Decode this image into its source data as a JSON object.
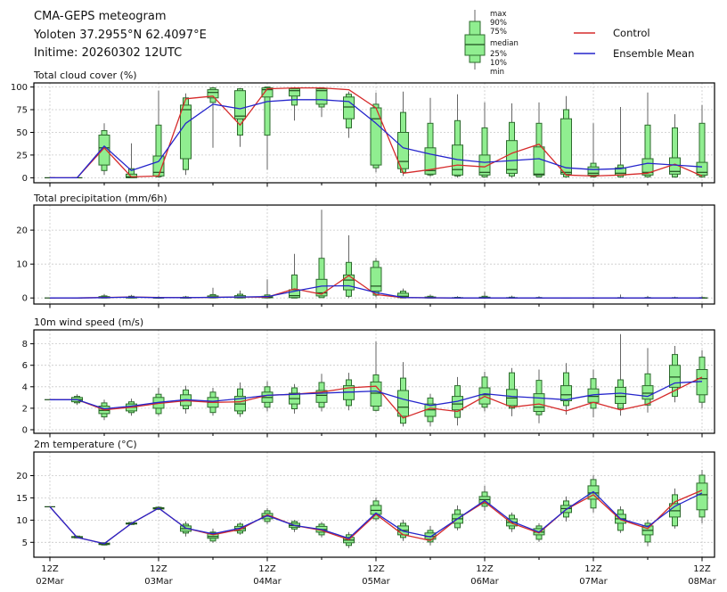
{
  "header": {
    "title": "CMA-GEPS meteogram",
    "location": "Yoloten 37.2955°N 62.4097°E",
    "inittime": "Initime: 20260302 12UTC"
  },
  "legend": {
    "box_labels": [
      "max",
      "90%",
      "75%",
      "median",
      "25%",
      "10%",
      "min"
    ],
    "control_label": "Control",
    "ensemble_label": "Ensemble Mean"
  },
  "style": {
    "control_color": "#d62b2b",
    "ensemble_color": "#2525cc",
    "box_fill": "#90ee90",
    "box_edge": "#2e6b2e",
    "median_color": "#1e4d1e",
    "whisker_color": "#666666",
    "grid_color": "#c9c9c9",
    "axis_color": "#000000"
  },
  "x_axis": {
    "start": "02Mar 12Z",
    "step_hours": 6,
    "n_steps": 25,
    "major_tick_labels": [
      {
        "hour": "12Z",
        "date": "02Mar"
      },
      {
        "hour": "12Z",
        "date": "03Mar"
      },
      {
        "hour": "12Z",
        "date": "04Mar"
      },
      {
        "hour": "12Z",
        "date": "05Mar"
      },
      {
        "hour": "12Z",
        "date": "06Mar"
      },
      {
        "hour": "12Z",
        "date": "07Mar"
      },
      {
        "hour": "12Z",
        "date": "08Mar"
      }
    ]
  },
  "chart_data": [
    {
      "type": "box",
      "id": "total-cloud-cover",
      "title": "Total cloud cover (%)",
      "ylim": [
        0,
        100
      ],
      "yticks": [
        0,
        25,
        50,
        75,
        100
      ],
      "box_stats_order": [
        "min",
        "p10",
        "p25",
        "median",
        "p75",
        "p90",
        "max"
      ],
      "boxes": [
        [
          0,
          0,
          0,
          0,
          0,
          0,
          0
        ],
        [
          0,
          0,
          0,
          0,
          0,
          0,
          0
        ],
        [
          3,
          8,
          14,
          33,
          47,
          52,
          60
        ],
        [
          0,
          0,
          0,
          1,
          4,
          10,
          38
        ],
        [
          0,
          1,
          2,
          6,
          24,
          58,
          96
        ],
        [
          3,
          9,
          21,
          75,
          80,
          88,
          93
        ],
        [
          33,
          83,
          88,
          94,
          97,
          99,
          100
        ],
        [
          34,
          47,
          65,
          68,
          96,
          98,
          99
        ],
        [
          9,
          47,
          89,
          97,
          99,
          100,
          100
        ],
        [
          63,
          80,
          90,
          96,
          98,
          99,
          100
        ],
        [
          67,
          78,
          81,
          96,
          98,
          99,
          100
        ],
        [
          44,
          55,
          65,
          78,
          89,
          92,
          95
        ],
        [
          6,
          11,
          14,
          65,
          77,
          81,
          94
        ],
        [
          2,
          6,
          10,
          18,
          50,
          72,
          95
        ],
        [
          1,
          3,
          4,
          8,
          33,
          60,
          88
        ],
        [
          0,
          2,
          3,
          9,
          36,
          63,
          92
        ],
        [
          0,
          1,
          3,
          6,
          25,
          55,
          83
        ],
        [
          0,
          2,
          5,
          9,
          41,
          61,
          82
        ],
        [
          0,
          1,
          3,
          4,
          34,
          60,
          83
        ],
        [
          0,
          1,
          4,
          6,
          65,
          75,
          90
        ],
        [
          0,
          1,
          3,
          5,
          12,
          16,
          60
        ],
        [
          0,
          1,
          3,
          5,
          11,
          14,
          78
        ],
        [
          0,
          1,
          3,
          6,
          21,
          58,
          94
        ],
        [
          0,
          1,
          4,
          7,
          22,
          55,
          70
        ],
        [
          0,
          1,
          3,
          6,
          17,
          60,
          80
        ]
      ],
      "control": [
        0,
        0,
        33,
        1,
        2,
        87,
        90,
        58,
        98,
        99,
        99,
        97,
        77,
        5,
        9,
        14,
        12,
        27,
        37,
        3,
        2,
        3,
        5,
        15,
        2
      ],
      "ensemble": [
        0,
        0,
        35,
        8,
        18,
        60,
        81,
        76,
        84,
        86,
        86,
        84,
        60,
        33,
        26,
        20,
        17,
        19,
        21,
        11,
        9,
        10,
        16,
        14,
        12
      ]
    },
    {
      "type": "box",
      "id": "total-precipitation",
      "title": "Total precipitation (mm/6h)",
      "ylim": [
        0,
        25
      ],
      "yticks": [
        0,
        10,
        20
      ],
      "box_stats_order": [
        "min",
        "p10",
        "p25",
        "median",
        "p75",
        "p90",
        "max"
      ],
      "boxes": [
        [
          0,
          0,
          0,
          0,
          0,
          0,
          0
        ],
        [
          0,
          0,
          0,
          0,
          0,
          0,
          0.1
        ],
        [
          0,
          0,
          0,
          0.1,
          0.4,
          0.6,
          1.2
        ],
        [
          0,
          0,
          0,
          0.1,
          0.3,
          0.5,
          0.9
        ],
        [
          0,
          0,
          0,
          0,
          0.1,
          0.2,
          0.5
        ],
        [
          0,
          0,
          0,
          0.05,
          0.15,
          0.3,
          0.6
        ],
        [
          0,
          0,
          0.05,
          0.25,
          0.6,
          1,
          3
        ],
        [
          0,
          0,
          0.05,
          0.3,
          0.7,
          1.1,
          2.2
        ],
        [
          0,
          0,
          0.05,
          0.2,
          0.5,
          0.9,
          5.5
        ],
        [
          0,
          0,
          0.1,
          0.7,
          2.4,
          6.8,
          13
        ],
        [
          0,
          0.1,
          0.6,
          1.5,
          5.5,
          11.7,
          26
        ],
        [
          0,
          0.5,
          2.4,
          5.3,
          6.8,
          10.5,
          18.5
        ],
        [
          0.2,
          0.8,
          2,
          3.5,
          9,
          10.8,
          11.8
        ],
        [
          0,
          0,
          0.1,
          0.5,
          1.4,
          2,
          2.8
        ],
        [
          0,
          0,
          0,
          0.1,
          0.3,
          0.5,
          1
        ],
        [
          0,
          0,
          0,
          0,
          0.1,
          0.2,
          0.5
        ],
        [
          0,
          0,
          0,
          0.05,
          0.25,
          0.5,
          1.8
        ],
        [
          0,
          0,
          0,
          0,
          0.1,
          0.25,
          0.7
        ],
        [
          0,
          0,
          0,
          0,
          0.05,
          0.15,
          0.5
        ],
        [
          0,
          0,
          0,
          0,
          0,
          0.05,
          0.2
        ],
        [
          0,
          0,
          0,
          0,
          0,
          0.05,
          0.3
        ],
        [
          0,
          0,
          0,
          0,
          0.05,
          0.1,
          1
        ],
        [
          0,
          0,
          0,
          0,
          0.05,
          0.15,
          0.6
        ],
        [
          0,
          0,
          0,
          0,
          0,
          0.1,
          0.4
        ],
        [
          0,
          0,
          0,
          0,
          0.05,
          0.1,
          0.5
        ]
      ],
      "control": [
        0,
        0,
        0.15,
        0.3,
        0.15,
        0.1,
        0.2,
        0.3,
        0.25,
        2.7,
        1.1,
        6.6,
        1,
        0.1,
        0.05,
        0,
        0,
        0,
        0,
        0,
        0,
        0,
        0,
        0,
        0
      ],
      "ensemble": [
        0,
        0,
        0.1,
        0.25,
        0.1,
        0.1,
        0.2,
        0.3,
        0.4,
        2,
        3.5,
        3.6,
        1.6,
        0.15,
        0.05,
        0,
        0,
        0,
        0,
        0,
        0,
        0,
        0,
        0,
        0
      ]
    },
    {
      "type": "box",
      "id": "10m-wind-speed",
      "title": "10m wind speed (m/s)",
      "ylim": [
        0,
        9
      ],
      "yticks": [
        0,
        2,
        4,
        6,
        8
      ],
      "box_stats_order": [
        "min",
        "p10",
        "p25",
        "median",
        "p75",
        "p90",
        "max"
      ],
      "boxes": [
        [
          2.8,
          2.8,
          2.8,
          2.8,
          2.8,
          2.8,
          2.8
        ],
        [
          2.3,
          2.5,
          2.6,
          2.8,
          3,
          3.1,
          3.3
        ],
        [
          0.9,
          1.2,
          1.5,
          1.8,
          2.2,
          2.5,
          2.8
        ],
        [
          1.3,
          1.6,
          1.75,
          2.1,
          2.4,
          2.6,
          2.9
        ],
        [
          1.3,
          1.5,
          2,
          2.5,
          3,
          3.3,
          3.9
        ],
        [
          1.5,
          1.95,
          2.25,
          2.75,
          3.25,
          3.7,
          4.1
        ],
        [
          1.3,
          1.6,
          2.1,
          2.55,
          3,
          3.5,
          3.9
        ],
        [
          1.2,
          1.5,
          1.75,
          2.4,
          3.1,
          3.8,
          4.4
        ],
        [
          1.7,
          2.1,
          2.55,
          3,
          3.5,
          4,
          4.5
        ],
        [
          1.5,
          1.95,
          2.4,
          2.9,
          3.4,
          3.9,
          4.25
        ],
        [
          1.7,
          2.1,
          2.55,
          3.2,
          3.65,
          4.4,
          5.2
        ],
        [
          1.8,
          2.25,
          2.8,
          3.5,
          4.1,
          4.65,
          5.3
        ],
        [
          1.7,
          1.8,
          2.2,
          3.4,
          4.45,
          5.1,
          8.2
        ],
        [
          0.3,
          0.6,
          1.25,
          2.1,
          3.65,
          4.8,
          6.3
        ],
        [
          0.3,
          0.75,
          1.25,
          1.85,
          2.4,
          2.95,
          3.35
        ],
        [
          0.4,
          1.15,
          1.85,
          2.4,
          3.1,
          4.1,
          4.9
        ],
        [
          1.7,
          2.1,
          2.4,
          3.25,
          3.9,
          4.9,
          5.4
        ],
        [
          1.25,
          2,
          2.25,
          2.95,
          3.75,
          5.3,
          5.75
        ],
        [
          0.6,
          1.4,
          1.7,
          2.1,
          3.35,
          4.6,
          5.6
        ],
        [
          1.4,
          2.25,
          2.7,
          3.25,
          4.1,
          5.3,
          6.2
        ],
        [
          1.15,
          2,
          2.55,
          3.1,
          3.8,
          4.75,
          5.6
        ],
        [
          1.3,
          2,
          2.45,
          3.1,
          3.95,
          4.65,
          8.9
        ],
        [
          1.6,
          2.3,
          2.85,
          3.4,
          4.1,
          5.2,
          7.6
        ],
        [
          2.55,
          3.1,
          3.95,
          4.9,
          6,
          7,
          7.8
        ],
        [
          2,
          2.55,
          3.25,
          4.75,
          5.6,
          6.75,
          7.4
        ]
      ],
      "control": [
        2.8,
        2.8,
        1.85,
        2.1,
        2.45,
        2.7,
        2.55,
        2.6,
        3.2,
        3.3,
        3.5,
        3.9,
        4.05,
        1.1,
        2,
        1.7,
        3.1,
        2.1,
        2.4,
        1.75,
        2.55,
        1.85,
        2.4,
        3.65,
        4.9
      ],
      "ensemble": [
        2.8,
        2.8,
        1.95,
        2.2,
        2.55,
        2.8,
        2.65,
        2.9,
        3.2,
        3.3,
        3.4,
        3.5,
        3.6,
        2.85,
        2.25,
        2.65,
        3.35,
        3.1,
        2.95,
        2.8,
        3.25,
        3.4,
        3.1,
        4.35,
        4.5
      ]
    },
    {
      "type": "box",
      "id": "2m-temperature",
      "title": "2m temperature (°C)",
      "ylim": [
        2,
        25
      ],
      "yticks": [
        5,
        10,
        15,
        20
      ],
      "box_stats_order": [
        "min",
        "p10",
        "p25",
        "median",
        "p75",
        "p90",
        "max"
      ],
      "boxes": [
        [
          13,
          13,
          13,
          13,
          13,
          13,
          13
        ],
        [
          5.9,
          6,
          6.05,
          6.1,
          6.3,
          6.4,
          6.5
        ],
        [
          4.3,
          4.4,
          4.5,
          4.65,
          4.8,
          4.9,
          5
        ],
        [
          8.9,
          9,
          9.1,
          9.2,
          9.35,
          9.45,
          9.6
        ],
        [
          12.3,
          12.4,
          12.5,
          12.65,
          12.8,
          12.9,
          13.1
        ],
        [
          6.3,
          7.1,
          7.5,
          8.1,
          8.7,
          9.1,
          9.7
        ],
        [
          4.9,
          5.3,
          5.9,
          6.3,
          7.1,
          7.3,
          8.1
        ],
        [
          6.7,
          7.1,
          7.6,
          8.1,
          8.6,
          9.1,
          9.5
        ],
        [
          9.1,
          9.7,
          10.3,
          10.9,
          11.5,
          12.1,
          12.7
        ],
        [
          7.3,
          8,
          8.4,
          8.8,
          9.3,
          9.7,
          10
        ],
        [
          6.1,
          6.7,
          7.3,
          7.9,
          8.6,
          9.1,
          9.6
        ],
        [
          3.7,
          4.3,
          4.9,
          5.5,
          6.1,
          6.7,
          7.3
        ],
        [
          9.7,
          10.3,
          11.3,
          12.2,
          13.3,
          14.3,
          15.1
        ],
        [
          5.3,
          6.1,
          6.7,
          7.7,
          8.7,
          9.3,
          10.1
        ],
        [
          4.3,
          5.1,
          5.7,
          6.3,
          7.1,
          7.7,
          8.7
        ],
        [
          7.7,
          8.3,
          9.3,
          10.3,
          11.3,
          12.3,
          13.3
        ],
        [
          12.1,
          13.1,
          13.7,
          14.6,
          15.3,
          16.3,
          17.7
        ],
        [
          7.3,
          8.1,
          8.7,
          9.5,
          10.3,
          11.1,
          11.7
        ],
        [
          5.1,
          5.7,
          6.7,
          7.3,
          8.1,
          8.7,
          9.3
        ],
        [
          9.7,
          10.7,
          11.7,
          12.6,
          13.3,
          14.3,
          15.3
        ],
        [
          11.7,
          12.7,
          14.7,
          16.1,
          17.7,
          19.1,
          20.1
        ],
        [
          7.1,
          7.7,
          9.3,
          10.3,
          11.3,
          12.3,
          13.1
        ],
        [
          4.1,
          5.1,
          6.7,
          7.7,
          8.7,
          9.3,
          10.1
        ],
        [
          8.1,
          8.7,
          10.7,
          12.1,
          13.7,
          15.7,
          17.1
        ],
        [
          9.3,
          10.7,
          12.3,
          15.7,
          18.3,
          20.1,
          21.3
        ]
      ],
      "control": [
        13,
        6.1,
        4.7,
        9.25,
        12.7,
        8.2,
        6.7,
        7.9,
        11.2,
        8.8,
        7.7,
        5.6,
        11.3,
        6.7,
        5.4,
        10.3,
        14.1,
        9.3,
        7.1,
        12.4,
        15.7,
        10.1,
        8.1,
        14.1,
        16.7
      ],
      "ensemble": [
        13,
        6.1,
        4.7,
        9.25,
        12.7,
        8.2,
        6.9,
        8.2,
        11,
        8.8,
        7.9,
        5.9,
        11.6,
        7.5,
        6.2,
        10.3,
        14.4,
        9.7,
        7.3,
        12.4,
        16.4,
        10.3,
        8.5,
        13.1,
        16.1
      ]
    }
  ]
}
